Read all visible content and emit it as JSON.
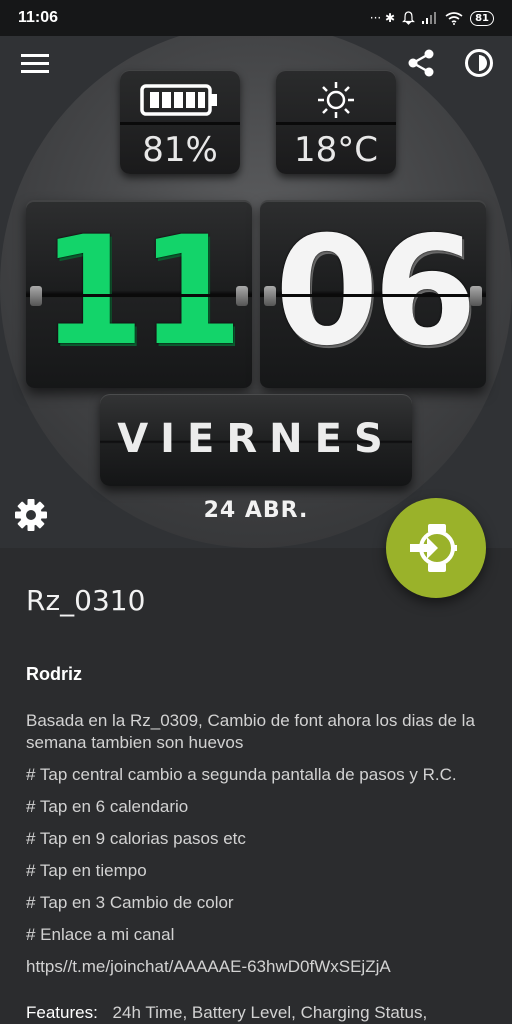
{
  "status_bar": {
    "time": "11:06",
    "indicators": "··· ✱",
    "battery": "81"
  },
  "watch_face": {
    "battery_percent": "81%",
    "temperature": "18°C",
    "hour": "11",
    "minute": "06",
    "weekday": "VIERNES",
    "date": "24 ABR.",
    "hour_color": "#13d46a",
    "minute_color": "#f4f4f4"
  },
  "toolbar": {
    "menu_icon": "menu-icon",
    "share_icon": "share-icon",
    "theme_icon": "theme-icon",
    "settings_icon": "settings-gear-icon",
    "fab_icon": "watch-install-icon",
    "fab_color": "#9ab22a"
  },
  "details": {
    "title": "Rz_0310",
    "author": "Rodriz",
    "description_lines": [
      "Basada en la Rz_0309, Cambio de font ahora los dias de la semana tambien son huevos",
      "# Tap central cambio a segunda pantalla de pasos y R.C.",
      "# Tap en 6 calendario",
      "# Tap en 9 calorias pasos etc",
      "# Tap en tiempo",
      "# Tap en 3 Cambio de color",
      "# Enlace a mi canal",
      "https//t.me/joinchat/AAAAAE-63hwD0fWxSEjZjA"
    ],
    "features_label": "Features:",
    "features_value": "24h Time,  Battery Level,  Charging Status,"
  }
}
